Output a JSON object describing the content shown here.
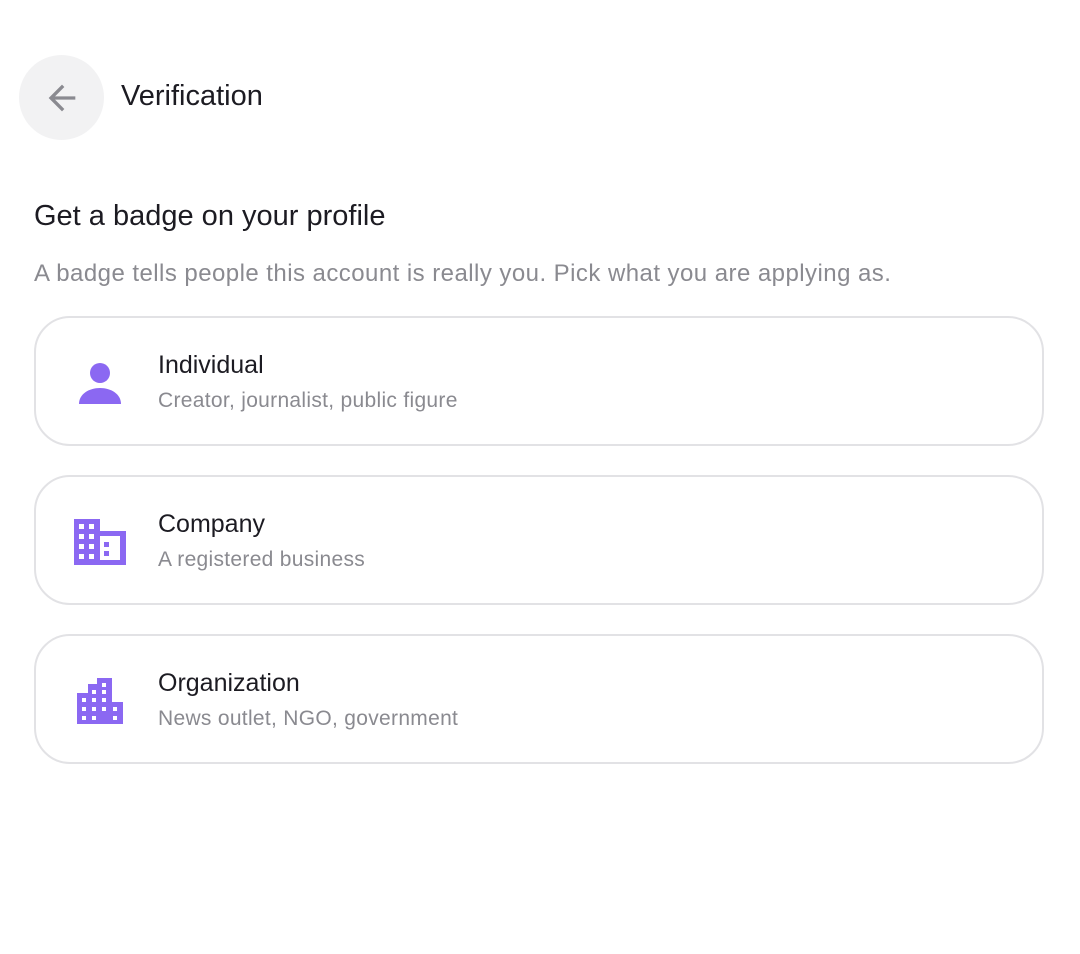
{
  "header": {
    "title": "Verification",
    "back_icon": "arrow-left-icon"
  },
  "intro": {
    "heading": "Get a badge on your profile",
    "subtitle": "A badge tells people this account is really you. Pick what you are applying as."
  },
  "options": [
    {
      "title": "Individual",
      "description": "Creator, journalist, public figure",
      "icon": "person-icon"
    },
    {
      "title": "Company",
      "description": "A registered business",
      "icon": "business-building-icon"
    },
    {
      "title": "Organization",
      "description": "News outlet, NGO, government",
      "icon": "city-building-icon"
    }
  ],
  "colors": {
    "accent": "#8b68f2",
    "text_primary": "#1c1b22",
    "text_secondary": "#8a8a90",
    "card_border": "#e2e2e5",
    "back_button_bg": "#f2f2f3"
  }
}
